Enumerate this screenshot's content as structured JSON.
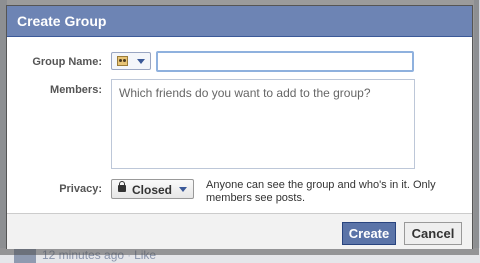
{
  "dialog": {
    "title": "Create Group"
  },
  "form": {
    "group_name_label": "Group Name:",
    "group_name_value": "",
    "members_label": "Members:",
    "members_placeholder": "Which friends do you want to add to the group?",
    "privacy_label": "Privacy:",
    "privacy_value": "Closed",
    "privacy_description": "Anyone can see the group and who's in it. Only members see posts."
  },
  "buttons": {
    "create": "Create",
    "cancel": "Cancel"
  },
  "background": {
    "timestamp": "12 minutes ago",
    "like": "Like"
  },
  "colors": {
    "header": "#6d84b4",
    "primary_button": "#5b74a8"
  },
  "icons": {
    "group_picker": "group-icon",
    "privacy": "lock-icon"
  }
}
